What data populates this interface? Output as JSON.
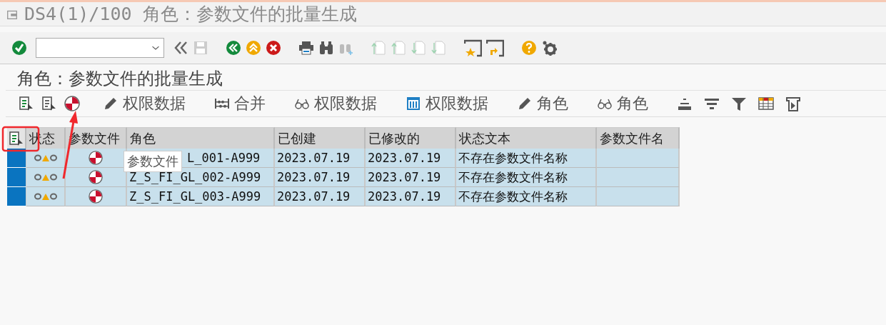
{
  "window": {
    "title": "DS4(1)/100 角色：参数文件的批量生成"
  },
  "heading": "角色：参数文件的批量生成",
  "app_toolbar": [
    {
      "kind": "pencil",
      "label": "权限数据"
    },
    {
      "kind": "abacus",
      "label": "合并"
    },
    {
      "kind": "glasses",
      "label": "权限数据"
    },
    {
      "kind": "grid",
      "label": "权限数据"
    },
    {
      "kind": "pencil",
      "label": "角色"
    },
    {
      "kind": "glasses",
      "label": "角色"
    }
  ],
  "table": {
    "columns": [
      "状态",
      "参数文件",
      "角色",
      "已创建",
      "已修改的",
      "状态文本",
      "参数文件名"
    ],
    "rows": [
      {
        "selected": true,
        "color": "#f0a800",
        "role": "L_001-A999",
        "tooltip": "参数文件",
        "created": "2023.07.19",
        "modified": "2023.07.19",
        "status_text": "不存在参数文件名称"
      },
      {
        "selected": true,
        "color": "#f0a800",
        "role": "Z_S_FI_GL_002-A999",
        "created": "2023.07.19",
        "modified": "2023.07.19",
        "status_text": "不存在参数文件名称"
      },
      {
        "selected": true,
        "color": "#f0a800",
        "role": "Z_S_FI_GL_003-A999",
        "created": "2023.07.19",
        "modified": "2023.07.19",
        "status_text": "不存在参数文件名称"
      }
    ]
  }
}
